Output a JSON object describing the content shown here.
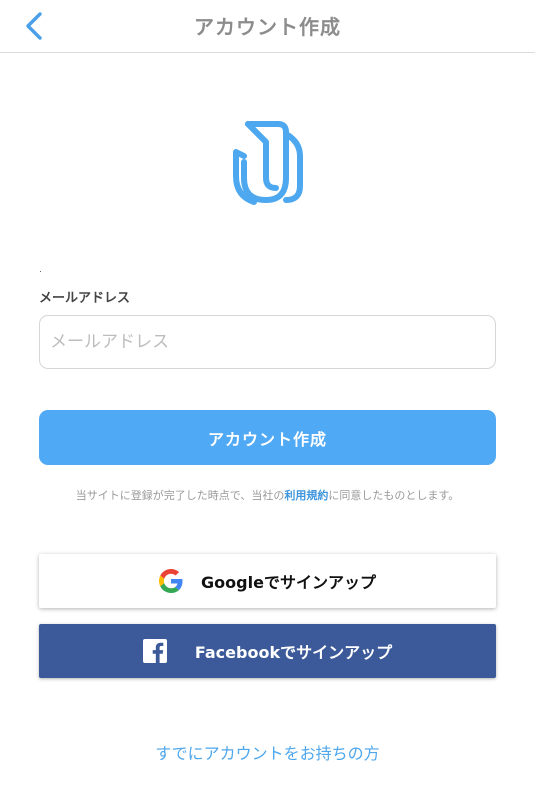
{
  "header": {
    "title": "アカウント作成",
    "back_icon": "chevron-left-icon"
  },
  "logo": {
    "icon": "app-logo-j-icon",
    "color": "#4da8f0"
  },
  "form": {
    "email_label": "メールアドレス",
    "email_placeholder": "メールアドレス",
    "email_value": "",
    "submit_label": "アカウント作成"
  },
  "terms": {
    "prefix": "当サイトに登録が完了した時点で、当社の",
    "link": "利用規約",
    "suffix": "に同意したものとします。"
  },
  "social": {
    "google_label": "Googleでサインアップ",
    "facebook_label": "Facebookでサインアップ"
  },
  "footer": {
    "login_link": "すでにアカウントをお持ちの方"
  },
  "colors": {
    "accent": "#50a9f5",
    "facebook": "#3c5a99",
    "link": "#3f96dc",
    "title": "#8c8c8c"
  }
}
